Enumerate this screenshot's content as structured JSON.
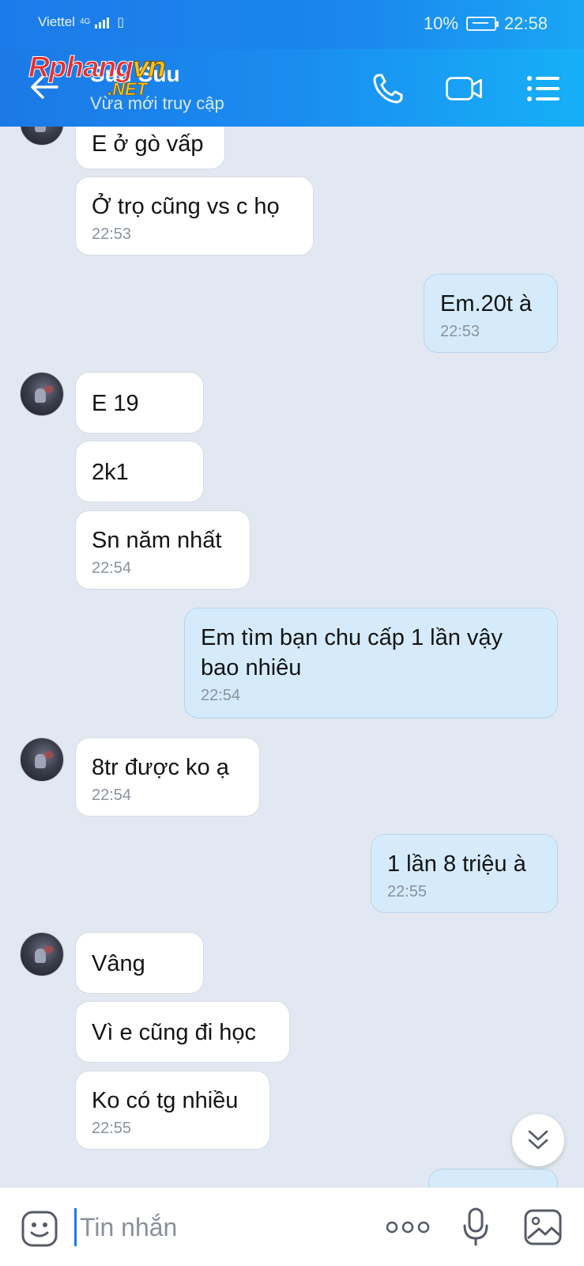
{
  "status_bar": {
    "carrier": "Viettel",
    "network": "4G",
    "battery": "10%",
    "time": "22:58"
  },
  "header": {
    "contact_name": "Suu Suu",
    "contact_status": "Vừa mới truy cập",
    "watermark_part1": "Rphang",
    "watermark_part2": "vn",
    "watermark_net": ".NET"
  },
  "messages": [
    {
      "side": "in",
      "text": "E ở gò vấp",
      "time": ""
    },
    {
      "side": "in",
      "text": "Ở trọ cũng vs c họ",
      "time": "22:53"
    },
    {
      "side": "out",
      "text": "Em.20t à",
      "time": "22:53"
    },
    {
      "side": "in",
      "text": "E 19",
      "time": ""
    },
    {
      "side": "in",
      "text": "2k1",
      "time": ""
    },
    {
      "side": "in",
      "text": "Sn năm nhất",
      "time": "22:54"
    },
    {
      "side": "out",
      "text_line1": "Em tìm bạn chu cấp 1 lần vậy",
      "text_line2": "bao nhiêu",
      "time": "22:54"
    },
    {
      "side": "in",
      "text": "8tr được ko ạ",
      "time": "22:54"
    },
    {
      "side": "out",
      "text": "1 lần 8 triệu à",
      "time": "22:55"
    },
    {
      "side": "in",
      "text": "Vâng",
      "time": ""
    },
    {
      "side": "in",
      "text": "Vì e cũng đi học",
      "time": ""
    },
    {
      "side": "in",
      "text": "Ko có tg nhiều",
      "time": "22:55"
    }
  ],
  "input": {
    "placeholder": "Tin nhắn"
  },
  "icons": {
    "back": "arrow-left-icon",
    "call": "phone-icon",
    "video": "video-camera-icon",
    "menu": "list-menu-icon",
    "sticker": "sticker-smile-icon",
    "more": "more-dots-icon",
    "mic": "microphone-icon",
    "image": "image-icon",
    "scroll": "double-chevron-down-icon"
  },
  "colors": {
    "header_start": "#1b79e6",
    "header_end": "#16b0f7",
    "chat_bg": "#e2e8f1",
    "bubble_out": "#d5ebfb",
    "bubble_in": "#ffffff"
  }
}
